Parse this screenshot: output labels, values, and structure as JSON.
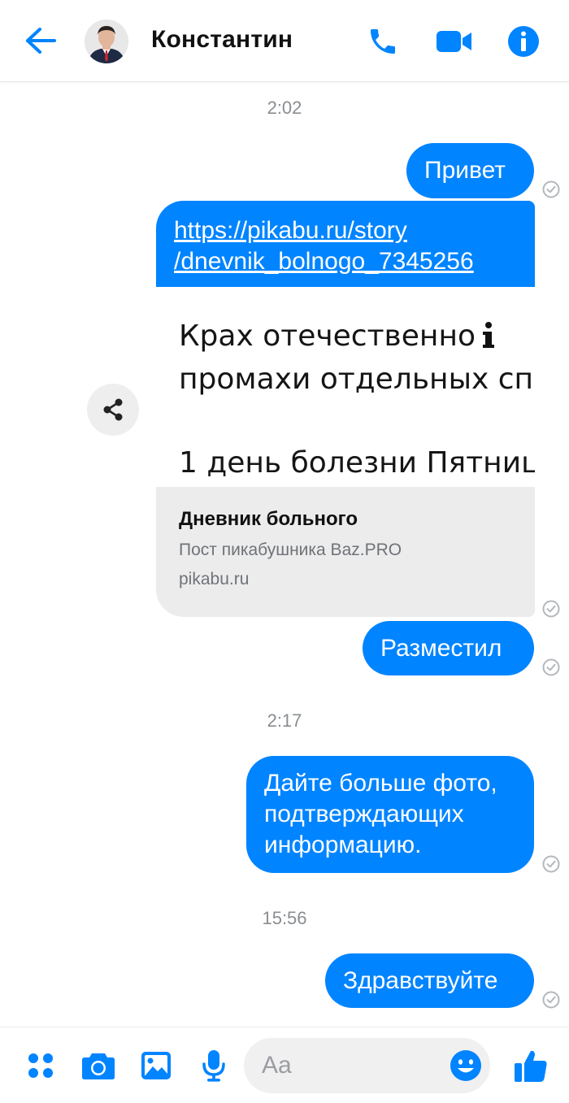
{
  "colors": {
    "accent": "#0084ff",
    "timestamp": "#8a8d91",
    "check": "#b4b7bb"
  },
  "header": {
    "back_icon": "arrow-left-icon",
    "contact_name": "Константин",
    "call_icon": "phone-icon",
    "video_icon": "video-camera-icon",
    "info_icon": "info-icon"
  },
  "messages": [
    {
      "type": "timestamp",
      "text": "2:02"
    },
    {
      "type": "outgoing",
      "text": "Привет",
      "status": "sent"
    },
    {
      "type": "outgoing-link",
      "link_text": "https://pikabu.ru/story /dnevnik_bolnogo_7345256",
      "link_line1": "https://pikabu.ru/story",
      "link_line2": "/dnevnik_bolnogo_7345256",
      "preview_lines": [
        "Крах отечественно",
        "промахи отдельных сп",
        "1 день болезни Пятниц"
      ],
      "preview_info_icon": "info-icon",
      "title": "Дневник больного",
      "description": "Пост пикабушника Baz.PRO",
      "domain": "pikabu.ru",
      "share_icon": "share-icon",
      "status": "sent"
    },
    {
      "type": "outgoing",
      "text": "Разместил",
      "status": "sent"
    },
    {
      "type": "timestamp",
      "text": "2:17"
    },
    {
      "type": "outgoing",
      "lines": [
        "Дайте больше фото,",
        "подтверждающих",
        "информацию."
      ],
      "status": "sent"
    },
    {
      "type": "timestamp",
      "text": "15:56"
    },
    {
      "type": "outgoing",
      "text": "Здравствуйте",
      "status": "sent"
    }
  ],
  "composer": {
    "apps_icon": "four-dots-icon",
    "camera_icon": "camera-icon",
    "gallery_icon": "image-icon",
    "mic_icon": "microphone-icon",
    "input_placeholder": "Aa",
    "emoji_icon": "smiley-icon",
    "like_icon": "thumbs-up-icon"
  }
}
